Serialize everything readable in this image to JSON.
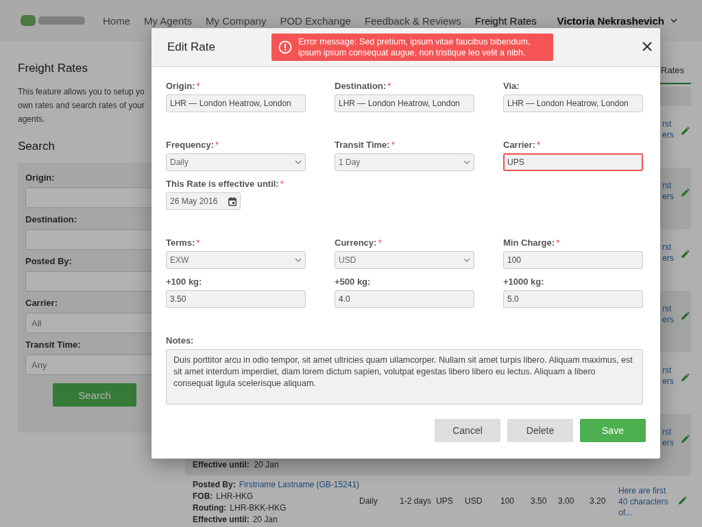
{
  "nav": {
    "links": [
      {
        "label": "Home",
        "selected": false
      },
      {
        "label": "My Agents",
        "selected": false
      },
      {
        "label": "My Company",
        "selected": false
      },
      {
        "label": "POD Exchange",
        "selected": false
      },
      {
        "label": "Feedback & Reviews",
        "selected": false
      },
      {
        "label": "Freight Rates",
        "selected": true
      }
    ],
    "user": "Victoria Nekrashevich"
  },
  "sidebar": {
    "title": "Freight Rates",
    "description": [
      "This feature allows you to setup yo",
      "own rates and search rates of your",
      "agents."
    ],
    "search_title": "Search",
    "fields": [
      {
        "label": "Origin:"
      },
      {
        "label": "Destination:"
      },
      {
        "label": "Posted By:"
      },
      {
        "label": "Carrier:",
        "placeholder": "All"
      },
      {
        "label": "Transit Time:",
        "placeholder": "Any"
      }
    ],
    "button": "Search"
  },
  "rates": {
    "tab": "Rates",
    "rows": [
      {
        "kind": "partial",
        "note": [
          "rst",
          "ers"
        ]
      },
      {
        "kind": "partial",
        "note": [
          "rst",
          "ers"
        ]
      },
      {
        "kind": "partial",
        "note": [
          "rst",
          "ers"
        ]
      },
      {
        "kind": "partial",
        "note": [
          "rst",
          "ers"
        ]
      },
      {
        "kind": "partial",
        "note": [
          "rst",
          "ers"
        ]
      },
      {
        "kind": "partial",
        "note": [
          "rst",
          "ers"
        ],
        "details": [
          {
            "label": "Effective until:",
            "value": "20 Jan",
            "link": false
          }
        ]
      },
      {
        "kind": "full",
        "details": [
          {
            "label": "Posted By:",
            "value": "Firstname Lastname (GB-15241)",
            "link": true
          },
          {
            "label": "FOB:",
            "value": "LHR-HKG",
            "link": false
          },
          {
            "label": "Routing:",
            "value": "LHR-BKK-HKG",
            "link": false
          },
          {
            "label": "Effective until:",
            "value": "20 Jan",
            "link": false
          }
        ],
        "cells": [
          "Daily",
          "1-2 days",
          "UPS",
          "USD",
          "100",
          "3.50",
          "3.00",
          "3.20"
        ],
        "note_text": "Here are first 40 characters of..."
      }
    ]
  },
  "modal": {
    "title": "Edit Rate",
    "error": "Error message: Sed pretium, ipsum vitae faucibus bibendum, ipsum ipsum consequat augue, non tristique leo velit a nibh.",
    "groups": [
      [
        {
          "label": "Origin:",
          "required": "*",
          "kind": "text",
          "value": "LHR — London Heatrow, London",
          "invalid": false
        },
        {
          "label": "Destination:",
          "required": "*",
          "kind": "text",
          "value": "LHR — London Heatrow, London",
          "invalid": false
        },
        {
          "label": "Via:",
          "kind": "text",
          "value": "LHR — London Heatrow, London",
          "invalid": false
        }
      ],
      [
        {
          "label": "Frequency:",
          "required": "*",
          "kind": "select",
          "value": "Daily",
          "invalid": false
        },
        {
          "label": "Transit Time:",
          "required": "*",
          "kind": "select",
          "value": "1 Day",
          "invalid": false
        },
        {
          "label": "Carrier:",
          "required": "*",
          "kind": "text",
          "value": "UPS",
          "invalid": true
        },
        {
          "label": "This Rate is effective until:",
          "required": "*",
          "kind": "date",
          "value": "26 May 2016",
          "invalid": false
        }
      ],
      [
        {
          "label": "Terms:",
          "required": "*",
          "kind": "select",
          "value": "EXW",
          "invalid": false
        },
        {
          "label": "Currency:",
          "required": "*",
          "kind": "select",
          "value": "USD",
          "invalid": false
        },
        {
          "label": "Min Charge:",
          "required": "*",
          "kind": "text",
          "value": "100",
          "invalid": false
        },
        {
          "label": "+100 kg:",
          "kind": "text",
          "value": "3.50",
          "invalid": false
        },
        {
          "label": "+500 kg:",
          "kind": "text",
          "value": "4.0",
          "invalid": false
        },
        {
          "label": "+1000 kg:",
          "kind": "text",
          "value": "5.0",
          "invalid": false
        }
      ]
    ],
    "notes": {
      "label": "Notes:",
      "value": "Duis porttitor arcu in odio tempor, sit amet ultricies quam ullamcorper. Nullam sit amet turpis libero. Aliquam maximus, est sit amet interdum imperdiet, diam lorem dictum sapien, volutpat egestas libero libero eu lectus. Aliquam a libero consequat ligula scelerisque aliquam."
    },
    "buttons": [
      {
        "label": "Cancel",
        "kind": "secondary"
      },
      {
        "label": "Delete",
        "kind": "secondary"
      },
      {
        "label": "Save",
        "kind": "primary"
      }
    ]
  }
}
